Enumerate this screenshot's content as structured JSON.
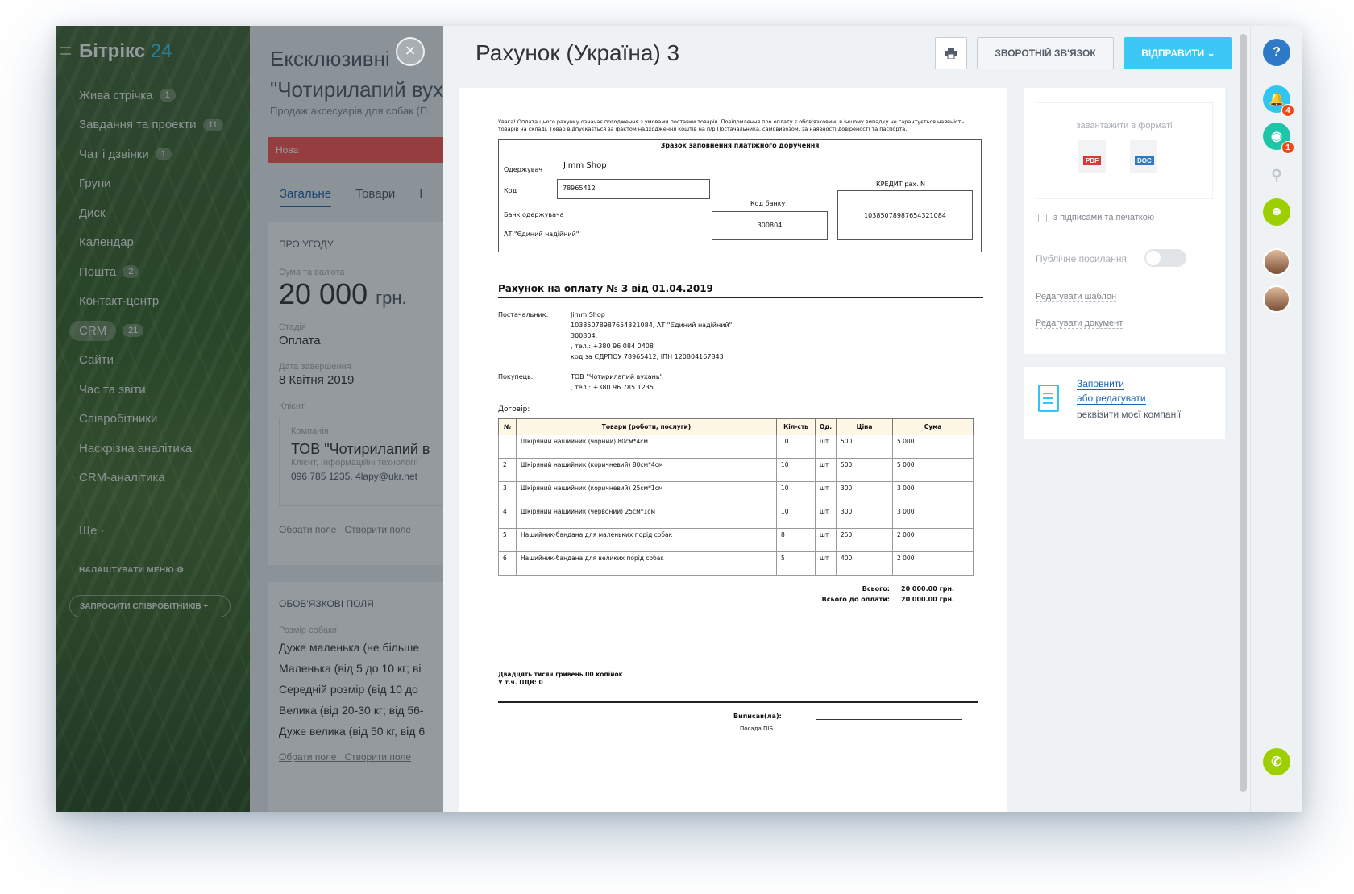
{
  "sidebar": {
    "logo_main": "Бітрікс",
    "logo_num": "24",
    "items": [
      {
        "label": "Жива стрічка",
        "count": "1"
      },
      {
        "label": "Завдання та проекти",
        "count": "11"
      },
      {
        "label": "Чат і дзвінки",
        "count": "1"
      },
      {
        "label": "Групи",
        "count": ""
      },
      {
        "label": "Диск",
        "count": ""
      },
      {
        "label": "Календар",
        "count": ""
      },
      {
        "label": "Пошта",
        "count": "2"
      },
      {
        "label": "Контакт-центр",
        "count": ""
      },
      {
        "label": "CRM",
        "count": "21"
      },
      {
        "label": "Сайти",
        "count": ""
      },
      {
        "label": "Час та звіти",
        "count": ""
      },
      {
        "label": "Співробітники",
        "count": ""
      },
      {
        "label": "Наскрізна аналітика",
        "count": ""
      },
      {
        "label": "CRM-аналітика",
        "count": ""
      }
    ],
    "more": "Ще ·",
    "setup": "НАЛАШТУВАТИ МЕНЮ",
    "invite": "ЗАПРОСИТИ СПІВРОБІТНИКІВ +"
  },
  "deal": {
    "title": "Ексклюзивні \"Чотирилапий вухань\"",
    "subtitle": "Продаж аксесуарів для собак (П",
    "stage": "Нова",
    "tabs": [
      "Загальне",
      "Товари",
      "І"
    ],
    "section_about": "ПРО УГОДУ",
    "amount_label": "Сума та валюта",
    "amount": "20 000",
    "currency": "грн.",
    "stage_label": "Стадія",
    "stage_value": "Оплата",
    "close_label": "Дата завершення",
    "close_value": "8 Квітня 2019",
    "client_label": "Клієнт",
    "company_label": "Компанія",
    "company_name": "ТОВ \"Чотирилапий в",
    "company_type": "Клієнт, Інформаційні технології",
    "company_contacts": "096 785 1235, 4lapy@ukr.net",
    "choose_field": "Обрати поле",
    "create_field": "Створити поле",
    "section_required": "ОБОВ'ЯЗКОВІ ПОЛЯ",
    "dog_size_label": "Розмір собаки",
    "dog_sizes": [
      "Дуже маленька (не більше",
      "Маленька (від 5 до 10 кг; ві",
      "Середній розмір (від 10 до",
      "Велика (від 20-30 кг; від 56-",
      "Дуже велика (від 50 кг, від 6"
    ]
  },
  "panel": {
    "title": "Рахунок (Україна) 3",
    "feedback": "ЗВОРОТНІЙ ЗВ'ЯЗОК",
    "send": "ВІДПРАВИТИ"
  },
  "invoice": {
    "warning": "Увага! Оплата цього рахунку означає погодження з умовами поставки товарів. Повідомлення про оплату є обов'язковим, в іншому випадку не гарантується наявність товарів на складі. Товар відпускається за фактом надходження коштів на п/р Постачальника, самовивозом, за наявності довіреності та паспорта.",
    "sample_title": "Зразок заповнення платіжного доручення",
    "recipient_label": "Одержувач",
    "recipient": "Jimm Shop",
    "code_label": "Код",
    "code": "78965412",
    "bank_code_label": "Код банку",
    "bank_code": "300804",
    "credit_label": "КРЕДИТ рах. N",
    "account": "10385078987654321084",
    "bank_label": "Банк одержувача",
    "bank_name": "АТ \"Єдиний надійний\"",
    "title": "Рахунок на оплату № 3 від 01.04.2019",
    "supplier_label": "Постачальник:",
    "supplier_lines": [
      "Jimm Shop",
      "10385078987654321084, АТ \"Єдиний надійний\",",
      "300804,",
      ", тел.: +380 96 084 0408",
      "код за ЄДРПОУ 78965412, ІПН 120804167843"
    ],
    "buyer_label": "Покупець:",
    "buyer_lines": [
      "ТОВ \"Чотирилапий вухань\"",
      ", тел.: +380 96 785 1235"
    ],
    "contract_label": "Договір:",
    "columns": [
      "№",
      "Товари (роботи, послуги)",
      "Кіл-сть",
      "Од.",
      "Ціна",
      "Сума"
    ],
    "rows": [
      [
        "1",
        "Шкіряний нашийник (чорний) 80см*4см",
        "10",
        "шт",
        "500",
        "5 000"
      ],
      [
        "2",
        "Шкіряний нашийник (коричневий) 80см*4см",
        "10",
        "шт",
        "500",
        "5 000"
      ],
      [
        "3",
        "Шкіряний нашийник (коричневий) 25см*1см",
        "10",
        "шт",
        "300",
        "3 000"
      ],
      [
        "4",
        "Шкіряний нашийник (червоний) 25см*1см",
        "10",
        "шт",
        "300",
        "3 000"
      ],
      [
        "5",
        "Нашийник-бандана для маленьких порід собак",
        "8",
        "шт",
        "250",
        "2 000"
      ],
      [
        "6",
        "Нашийник-бандана для великих порід собак",
        "5",
        "шт",
        "400",
        "2 000"
      ]
    ],
    "total_label": "Всього:",
    "total": "20 000.00 грн.",
    "due_label": "Всього до оплати:",
    "due": "20 000.00 грн.",
    "words": "Двадцять тисяч гривень 00 копійок",
    "vat": "У т.ч. ПДВ: 0",
    "signed_label": "Виписав(ла):",
    "position_label": "Посада ПІБ"
  },
  "options": {
    "download_label": "завантажити в форматі",
    "pdf": "PDF",
    "doc": "DOC",
    "with_sign": "з підписами та печаткою",
    "public_link": "Публічне посилання",
    "public_on": false,
    "edit_template": "Редагувати шаблон",
    "edit_document": "Редагувати документ",
    "fill": "Заповнити",
    "or_edit": "або редагувати",
    "company_req": "реквізити моєї компанії"
  },
  "rail": {
    "help": "?",
    "notif_count": "4",
    "chat_count": "1"
  },
  "colors": {
    "accent": "#3bc8f5",
    "stage": "#ff5752",
    "link": "#2067b0",
    "phone": "#9dcf00"
  }
}
